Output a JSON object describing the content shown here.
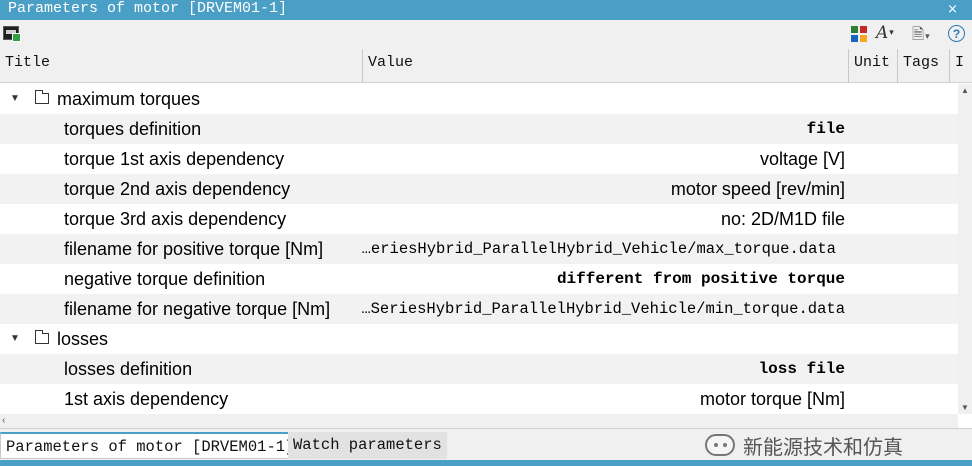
{
  "window": {
    "title": "Parameters of motor [DRVEM01-1]",
    "close_glyph": "×"
  },
  "toolbar": {
    "left_icon": "motor-add-icon",
    "right_icons": [
      "layout-grid-icon",
      "font-icon",
      "document-settings-icon",
      "help-icon"
    ],
    "font_glyph": "A",
    "help_glyph": "?"
  },
  "table": {
    "columns": [
      "Title",
      "Value",
      "Unit",
      "Tags",
      "I"
    ],
    "groups": [
      {
        "label": "maximum torques",
        "rows": [
          {
            "title": "torques definition",
            "value": "file"
          },
          {
            "title": "torque 1st axis dependency",
            "value": "voltage [V]"
          },
          {
            "title": "torque 2nd axis dependency",
            "value": "motor speed [rev/min]"
          },
          {
            "title": "torque 3rd axis dependency",
            "value": "no: 2D/M1D file"
          },
          {
            "title": "filename for positive torque [Nm]",
            "value": "…eriesHybrid_ParallelHybrid_Vehicle/max_torque.data"
          },
          {
            "title": "negative torque definition",
            "value": "different from positive torque"
          },
          {
            "title": "filename for negative torque [Nm]",
            "value": "…SeriesHybrid_ParallelHybrid_Vehicle/min_torque.data"
          }
        ]
      },
      {
        "label": "losses",
        "rows": [
          {
            "title": "losses definition",
            "value": "loss file"
          },
          {
            "title": "1st axis dependency",
            "value": "motor torque [Nm]"
          }
        ]
      }
    ]
  },
  "tabs": [
    "Parameters of motor [DRVEM01-1]",
    "Watch parameters"
  ],
  "watermark": "新能源技术和仿真",
  "colors": {
    "accent": "#4a9fc6",
    "row_alt": "#f2f2f2"
  }
}
